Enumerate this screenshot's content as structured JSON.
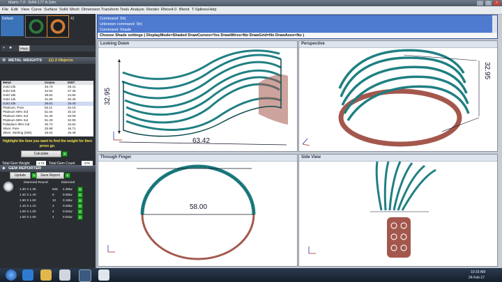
{
  "window": {
    "title": "Matrix 7.0 - BAN-177 A.3dm"
  },
  "menu": [
    "File",
    "Edit",
    "View",
    "Curve",
    "Surface",
    "Solid",
    "Mesh",
    "Dimension",
    "Transform",
    "Tools",
    "Analyze",
    "Render",
    "Rhino4.0",
    "Blend",
    "T-Splines",
    "Help"
  ],
  "left_panel": {
    "layer_name": "Default",
    "thumb_count": "42",
    "mini_toolbar_label": "Magic",
    "metal_weights": {
      "title": "METAL WEIGHTS",
      "objects_label": "(1) 2 Objects",
      "columns": [
        "Metal",
        "Grams",
        "DWT"
      ],
      "rows": [
        [
          "Gold 24k",
          "45.73",
          "29.41"
        ],
        [
          "Gold 22k",
          "42.52",
          "27.35"
        ],
        [
          "Gold 18k",
          "38.62",
          "24.84"
        ],
        [
          "Gold 14k",
          "31.80",
          "20.45"
        ],
        [
          "Gold 10k",
          "28.61",
          "18.40"
        ],
        [
          "Platinum, Pure",
          "53.11",
          "34.16"
        ],
        [
          "Platinum 95% Ind",
          "51.54",
          "33.15"
        ],
        [
          "Platinum 90% Ind",
          "51.45",
          "33.09"
        ],
        [
          "Platinum 85% Ind",
          "51.30",
          "32.99"
        ],
        [
          "Palladium 95% Ind",
          "25.72",
          "16.54"
        ],
        [
          "Silver, Pure",
          "25.98",
          "16.71"
        ],
        [
          "Silver, Sterling (925)",
          "25.62",
          "16.48"
        ]
      ],
      "hint": "Highlight the item you want to find the weight for then press go.",
      "calculate_label": "Calculate"
    },
    "gem_reporter": {
      "title": "GEM REPORTER",
      "total_weight_label": "Total Gem Weight",
      "total_weight_value": "4.73",
      "total_count_label": "Total Gem Count",
      "total_count_value": "576",
      "update_label": "Update",
      "save_label": "Save Report",
      "shape": "Diamond Round",
      "shape_short": "Diamond",
      "rows": [
        [
          "1.30 X 1.30",
          "526",
          "4.35tw"
        ],
        [
          "1.40 X 1.40",
          "6",
          "0.06tw"
        ],
        [
          "1.50 X 1.50",
          "12",
          "0.15tw"
        ],
        [
          "1.10 X 1.10",
          "4",
          "0.03tw"
        ],
        [
          "1.00 X 1.00",
          "4",
          "0.01tw"
        ],
        [
          "1.00 X 1.00",
          "4",
          "0.01tw"
        ]
      ]
    }
  },
  "command": {
    "lines": [
      "Command: Sh|",
      "Unknown command: Sh|",
      "Command: Shade"
    ],
    "prompt": "Choose Shade settings ( DisplayMode=Shaded  DrawCurves=Yes  DrawWires=No  DrawGrid=No  DrawAxes=No )"
  },
  "viewports": {
    "top_left": {
      "name": "Looking Down",
      "dim_height": "32.95",
      "dim_width": "63.42"
    },
    "top_right": {
      "name": "Perspective",
      "dim_height": "32.95"
    },
    "bottom_left": {
      "name": "Through Finger",
      "dim_width": "58.00"
    },
    "bottom_right": {
      "name": "Side View"
    }
  },
  "taskbar": {
    "time": "10:16 AM",
    "date": "24-Feb-17"
  },
  "colors": {
    "metal": "#1f7f82",
    "metal_dark": "#0f4a4e",
    "rose": "#a4574c",
    "panel": "#2a2e33",
    "cmd_bg": "#4f7ad0"
  }
}
